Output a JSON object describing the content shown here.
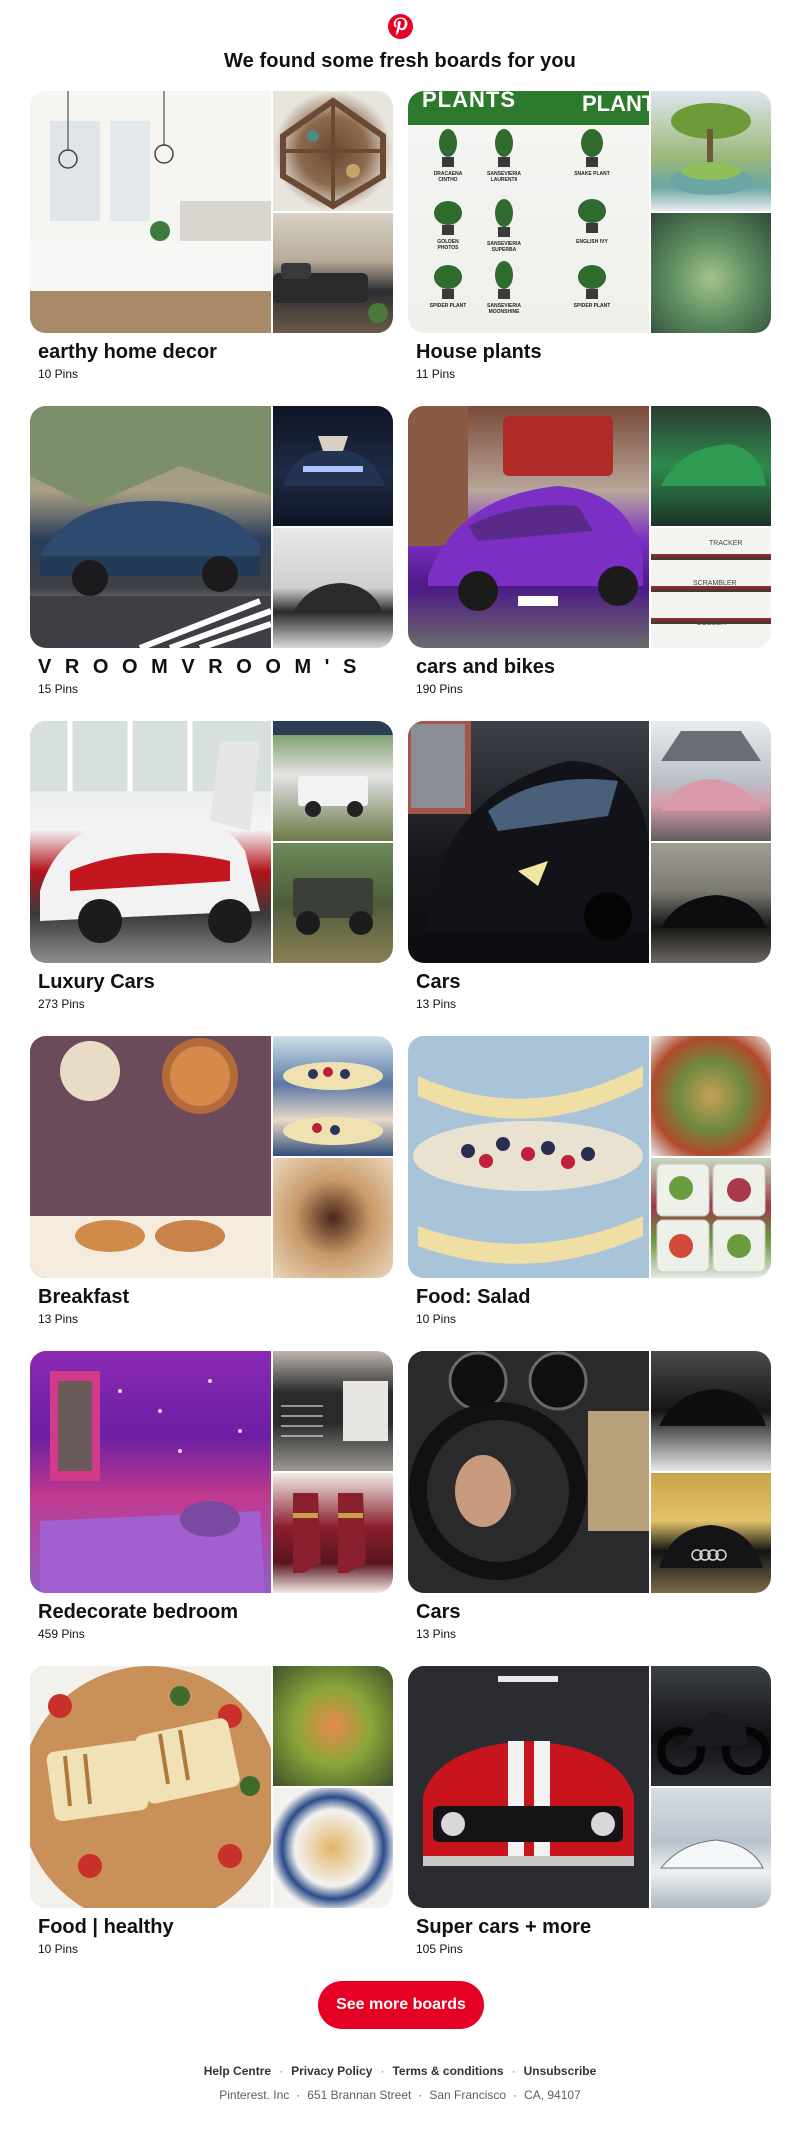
{
  "header": {
    "logo_icon": "pinterest-logo-icon",
    "brand_color": "#e60023",
    "headline": "We found some fresh boards for you"
  },
  "boards": [
    {
      "title": "earthy home decor",
      "count": "10 Pins",
      "images": [
        "kitchen",
        "shelf",
        "sofa"
      ]
    },
    {
      "title": "House plants",
      "count": "11 Pins",
      "images": [
        "plants",
        "bonsai",
        "succ"
      ]
    },
    {
      "title": "V R O O M V R O O M ' S",
      "count": "15 Pins",
      "images": [
        "bmw",
        "bmwnight",
        "audiwhite"
      ]
    },
    {
      "title": "cars and bikes",
      "count": "190 Pins",
      "images": [
        "lambo",
        "greencar",
        "bikes"
      ]
    },
    {
      "title": "Luxury Cars",
      "count": "273 Pins",
      "images": [
        "veneno",
        "gwagon",
        "jeep"
      ]
    },
    {
      "title": "Cars",
      "count": "13 Pins",
      "images": [
        "huracan",
        "pinkcar",
        "blackcar"
      ]
    },
    {
      "title": "Breakfast",
      "count": "13 Pins",
      "images": [
        "scallops",
        "berries",
        "donut"
      ]
    },
    {
      "title": "Food: Salad",
      "count": "10 Pins",
      "images": [
        "banana",
        "bowl",
        "mealprep"
      ]
    },
    {
      "title": "Redecorate bedroom",
      "count": "459 Pins",
      "images": [
        "bedroom",
        "article",
        "boots"
      ]
    },
    {
      "title": "Cars",
      "count": "13 Pins",
      "images": [
        "wheel",
        "audisnow",
        "audiwall"
      ]
    },
    {
      "title": "Food | healthy",
      "count": "10 Pins",
      "images": [
        "halloumi",
        "shrimp",
        "quesadilla"
      ]
    },
    {
      "title": "Super cars + more",
      "count": "105 Pins",
      "images": [
        "mustang",
        "bike",
        "zenvo"
      ]
    }
  ],
  "plants_text": {
    "header_left": "PLANTS",
    "header_right": "PLANT",
    "labels": [
      "DRACAENA CINTHO",
      "SANSEVIERIA LAURENTII",
      "SNAKE PLANT",
      "GOLDEN PHOTOS",
      "SANSEVIERIA SUPERBA",
      "ENGLISH IVY",
      "SPIDER PLANT",
      "SANSEVIERIA MOONSHINE",
      "SPIDER PLANT"
    ]
  },
  "bikes_text": [
    "TRACKER",
    "SCRAMBLER",
    "BOBBER"
  ],
  "cta": {
    "label": "See more boards"
  },
  "footer": {
    "links": [
      "Help Centre",
      "Privacy Policy",
      "Terms & conditions",
      "Unsubscribe"
    ],
    "address": [
      "Pinterest. Inc",
      "651 Brannan Street",
      "San Francisco",
      "CA, 94107"
    ]
  }
}
